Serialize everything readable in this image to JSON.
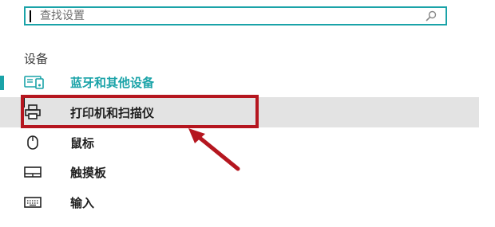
{
  "search": {
    "placeholder": "查找设置",
    "value": ""
  },
  "section": {
    "title": "设备"
  },
  "nav": {
    "items": [
      {
        "label": "蓝牙和其他设备",
        "icon": "bluetooth-devices-icon",
        "selected": true
      },
      {
        "label": "打印机和扫描仪",
        "icon": "printer-icon",
        "hovered": true
      },
      {
        "label": "鼠标",
        "icon": "mouse-icon"
      },
      {
        "label": "触摸板",
        "icon": "touchpad-icon"
      },
      {
        "label": "输入",
        "icon": "keyboard-icon"
      }
    ]
  },
  "colors": {
    "accent": "#1aa3a8",
    "highlight": "#b5161f",
    "hover_bg": "#e3e3e3"
  }
}
